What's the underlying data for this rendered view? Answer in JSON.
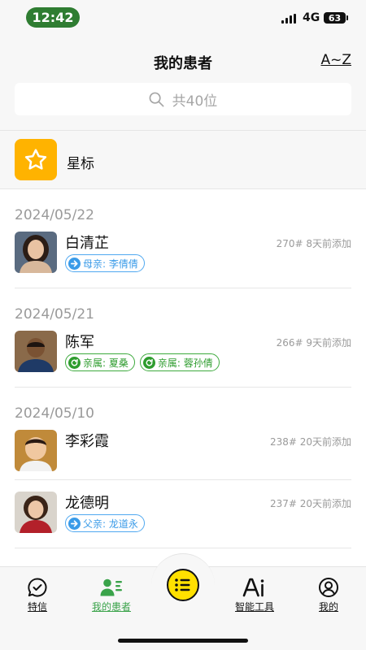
{
  "status_bar": {
    "time": "12:42",
    "network": "4G",
    "battery": "63"
  },
  "header": {
    "title": "我的患者",
    "sort_label": "A~Z"
  },
  "search": {
    "placeholder": "共40位"
  },
  "starred": {
    "label": "星标"
  },
  "groups": [
    {
      "date": "2024/05/22",
      "patients": [
        {
          "name": "白清芷",
          "meta": "270# 8天前添加",
          "tags": [
            {
              "text": "母亲: 李倩倩",
              "style": "blue",
              "icon": "arrow-right-icon"
            }
          ]
        }
      ]
    },
    {
      "date": "2024/05/21",
      "patients": [
        {
          "name": "陈军",
          "meta": "266# 9天前添加",
          "tags": [
            {
              "text": "亲属: 夏桑",
              "style": "green",
              "icon": "refresh-icon"
            },
            {
              "text": "亲属: 蓉孙倩",
              "style": "green",
              "icon": "refresh-icon"
            }
          ]
        }
      ]
    },
    {
      "date": "2024/05/10",
      "patients": [
        {
          "name": "李彩霞",
          "meta": "238# 20天前添加",
          "tags": []
        },
        {
          "name": "龙德明",
          "meta": "237# 20天前添加",
          "tags": [
            {
              "text": "父亲: 龙道永",
              "style": "blue",
              "icon": "arrow-right-icon"
            }
          ]
        }
      ]
    }
  ],
  "tabbar": {
    "tabs": [
      {
        "label": "特信",
        "icon": "chat-check-icon",
        "active": false
      },
      {
        "label": "我的患者",
        "icon": "patients-icon",
        "active": true
      },
      {
        "label": "智能工具",
        "icon": "ai-icon",
        "active": false
      },
      {
        "label": "我的",
        "icon": "profile-icon",
        "active": false
      }
    ],
    "center_icon": "list-menu-icon"
  },
  "colors": {
    "accent_green": "#3aa34a",
    "star_yellow": "#ffb300",
    "tag_blue": "#3a9be8",
    "tag_green": "#2e9c2e",
    "fab_yellow": "#ffe000"
  }
}
